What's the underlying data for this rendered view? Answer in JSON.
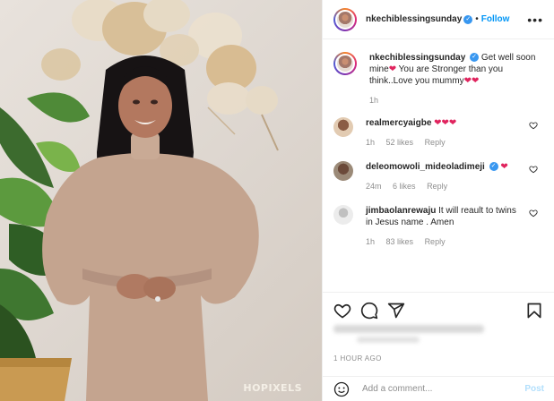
{
  "photo": {
    "watermark": "HOPIXELS"
  },
  "header": {
    "username": "nkechiblessingsunday",
    "follow_label": "Follow",
    "dot": "•",
    "more_icon": "more-horizontal-icon"
  },
  "caption": {
    "username": "nkechiblessingsunday",
    "text_part1": "Get well soon mine",
    "text_part2": " You are Stronger than you think..Love you mummy",
    "time": "1h"
  },
  "comments": [
    {
      "username": "realmercyaigbe",
      "text": "",
      "hearts": "❤❤❤",
      "time": "1h",
      "likes": "52 likes",
      "reply": "Reply"
    },
    {
      "username": "deleomowoli_mideoladimeji",
      "text": "",
      "hearts": "❤",
      "time": "24m",
      "likes": "6 likes",
      "reply": "Reply"
    },
    {
      "username": "jimbaolanrewaju",
      "text": "It will reault to twins in Jesus name . Amen",
      "hearts": "",
      "time": "1h",
      "likes": "83 likes",
      "reply": "Reply"
    }
  ],
  "footer": {
    "time_ago": "1 HOUR AGO",
    "add_comment_placeholder": "Add a comment...",
    "post_label": "Post"
  },
  "colors": {
    "link": "#0095f6",
    "heart": "#e0245e",
    "verified": "#3897f0",
    "muted": "#8e8e8e"
  }
}
